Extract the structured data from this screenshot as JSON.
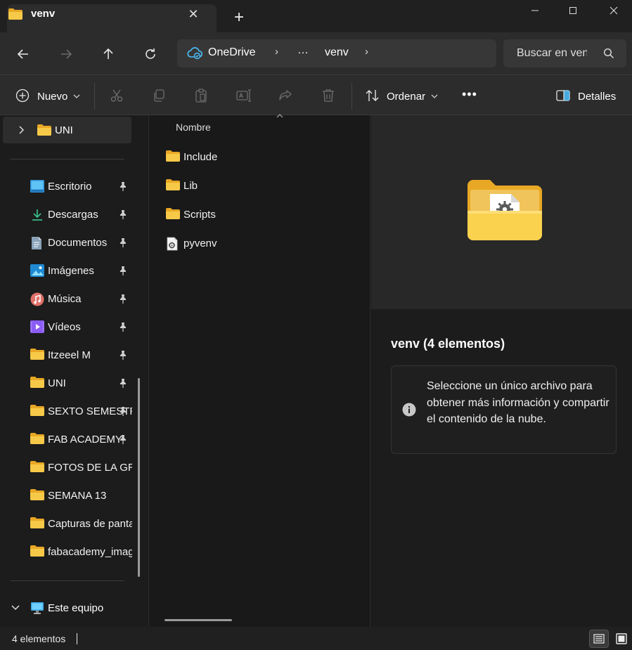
{
  "window": {
    "tab_title": "venv",
    "tab_close_glyph": "✕",
    "new_tab_glyph": "+",
    "controls": [
      "minimize-icon",
      "maximize-icon",
      "close-icon"
    ]
  },
  "address": {
    "breadcrumb": [
      "OneDrive",
      "…",
      "venv"
    ],
    "cloud_icon": "onedrive-cloud-icon",
    "separator_glyph": "›",
    "search_placeholder": "Buscar en venv"
  },
  "toolbar": {
    "new_label": "Nuevo",
    "sort_label": "Ordenar",
    "more_glyph": "•••",
    "details_label": "Detalles",
    "actions": [
      "cut-icon",
      "copy-icon",
      "paste-icon",
      "rename-icon",
      "share-icon",
      "delete-icon"
    ]
  },
  "navigation": {
    "top_item": "UNI",
    "quick_access": [
      {
        "label": "Escritorio",
        "icon": "desktop-icon",
        "pinned": true
      },
      {
        "label": "Descargas",
        "icon": "download-icon",
        "pinned": true
      },
      {
        "label": "Documentos",
        "icon": "document-icon",
        "pinned": true
      },
      {
        "label": "Imágenes",
        "icon": "pictures-icon",
        "pinned": true
      },
      {
        "label": "Música",
        "icon": "music-icon",
        "pinned": true
      },
      {
        "label": "Vídeos",
        "icon": "videos-icon",
        "pinned": true
      },
      {
        "label": "Itzeeel M",
        "icon": "folder-icon",
        "pinned": true
      },
      {
        "label": "UNI",
        "icon": "folder-icon",
        "pinned": true
      },
      {
        "label": "SEXTO SEMESTRE",
        "icon": "folder-icon",
        "pinned": true
      },
      {
        "label": "FAB ACADEMY",
        "icon": "folder-icon",
        "pinned": true
      },
      {
        "label": "FOTOS DE LA GRADUACION",
        "icon": "folder-icon",
        "pinned": false
      },
      {
        "label": "SEMANA 13",
        "icon": "folder-icon",
        "pinned": false
      },
      {
        "label": "Capturas de pantalla",
        "icon": "folder-icon",
        "pinned": false
      },
      {
        "label": "fabacademy_images",
        "icon": "folder-icon",
        "pinned": false
      }
    ],
    "this_pc": "Este equipo"
  },
  "file_list": {
    "column_header": "Nombre",
    "sort_indicator": "sort-ascending-icon",
    "items": [
      {
        "name": "Include",
        "type": "folder"
      },
      {
        "name": "Lib",
        "type": "folder"
      },
      {
        "name": "Scripts",
        "type": "folder"
      },
      {
        "name": "pyvenv",
        "type": "config-file"
      }
    ]
  },
  "details": {
    "title": "venv (4 elementos)",
    "info_message": "Seleccione un único archivo para obtener más información y compartir el contenido de la nube."
  },
  "status": {
    "item_count": "4 elementos"
  },
  "colors": {
    "folder": "#f3c244",
    "folder_dark": "#e8a825",
    "accent_cloud": "#4cc2ff",
    "background": "#1c1c1c",
    "chrome": "#2c2c2c"
  }
}
